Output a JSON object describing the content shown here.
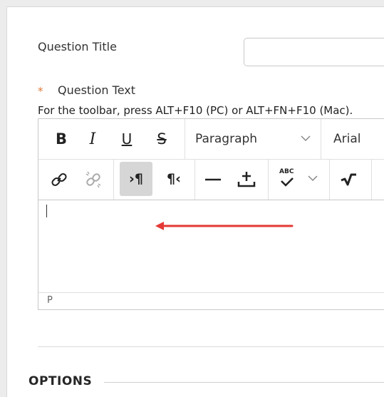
{
  "form": {
    "question_title_label": "Question Title",
    "question_title_value": "",
    "required_marker": "*",
    "question_text_label": "Question Text",
    "toolbar_hint": "For the toolbar, press ALT+F10 (PC) or ALT+FN+F10 (Mac)."
  },
  "toolbar": {
    "bold": "B",
    "italic": "I",
    "underline": "U",
    "strikethrough": "S",
    "block_format": "Paragraph",
    "font_family": "Arial",
    "ltr": "›¶",
    "rtl": "¶‹",
    "hr": "—",
    "spellcheck": "ABC"
  },
  "editor": {
    "content": "",
    "status_path": "P"
  },
  "sections": {
    "options_heading": "OPTIONS"
  },
  "colors": {
    "arrow": "#e53935",
    "required": "#e07a3c",
    "active_button_bg": "#d6d6d6"
  }
}
